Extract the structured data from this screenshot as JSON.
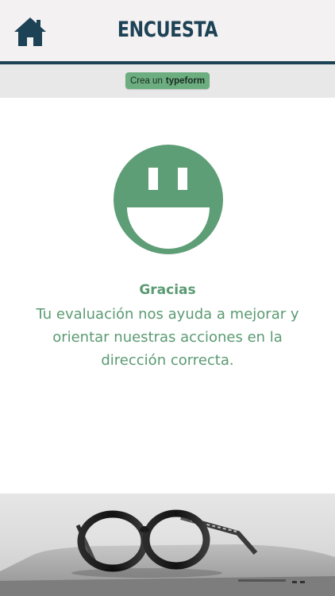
{
  "header": {
    "title": "ENCUESTA",
    "home_icon": "home-icon",
    "brand_color": "#1d4256"
  },
  "typeform_badge": {
    "prefix": "Crea un",
    "brand": "typeform",
    "color": "#6dae80"
  },
  "thanks": {
    "icon": "smiley-face-icon",
    "title": "Gracias",
    "message": "Tu evaluación nos ayuda a mejorar y orientar nuestras acciones en la dirección correcta.",
    "accent_color": "#5a9a72"
  },
  "footer_image": {
    "icon": "glasses-on-laptop-photo"
  }
}
